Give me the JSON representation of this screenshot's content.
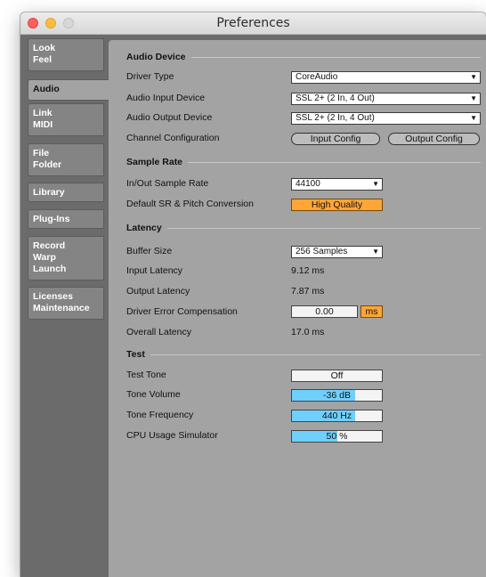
{
  "window": {
    "title": "Preferences"
  },
  "sidebar": {
    "tabs": [
      {
        "lines": [
          "Look",
          "Feel"
        ],
        "active": false
      },
      {
        "lines": [
          "Audio"
        ],
        "active": true
      },
      {
        "lines": [
          "Link",
          "MIDI"
        ],
        "active": false
      },
      {
        "lines": [
          "File",
          "Folder"
        ],
        "active": false
      },
      {
        "lines": [
          "Library"
        ],
        "active": false
      },
      {
        "lines": [
          "Plug-Ins"
        ],
        "active": false
      },
      {
        "lines": [
          "Record",
          "Warp",
          "Launch"
        ],
        "active": false
      },
      {
        "lines": [
          "Licenses",
          "Maintenance"
        ],
        "active": false
      }
    ]
  },
  "audio_device": {
    "heading": "Audio Device",
    "driver_type_label": "Driver Type",
    "driver_type_value": "CoreAudio",
    "input_device_label": "Audio Input Device",
    "input_device_value": "SSL 2+ (2 In, 4 Out)",
    "output_device_label": "Audio Output Device",
    "output_device_value": "SSL 2+ (2 In, 4 Out)",
    "channel_config_label": "Channel Configuration",
    "input_config_button": "Input Config",
    "output_config_button": "Output Config"
  },
  "sample_rate": {
    "heading": "Sample Rate",
    "inout_label": "In/Out Sample Rate",
    "inout_value": "44100",
    "default_sr_label": "Default SR & Pitch Conversion",
    "default_sr_value": "High Quality"
  },
  "latency": {
    "heading": "Latency",
    "buffer_label": "Buffer Size",
    "buffer_value": "256 Samples",
    "input_latency_label": "Input Latency",
    "input_latency_value": "9.12 ms",
    "output_latency_label": "Output Latency",
    "output_latency_value": "7.87 ms",
    "driver_error_label": "Driver Error Compensation",
    "driver_error_value": "0.00",
    "driver_error_unit": "ms",
    "overall_label": "Overall Latency",
    "overall_value": "17.0 ms"
  },
  "test": {
    "heading": "Test",
    "tone_label": "Test Tone",
    "tone_value": "Off",
    "volume_label": "Tone Volume",
    "volume_value": "-36 dB",
    "volume_fill": 0.7,
    "frequency_label": "Tone Frequency",
    "frequency_value": "440 Hz",
    "frequency_fill": 0.7,
    "cpu_label": "CPU Usage Simulator",
    "cpu_value": "50 %",
    "cpu_fill": 0.5
  },
  "icons": {
    "dropdown_arrow": "chevron-down-icon"
  },
  "colors": {
    "accent_orange": "#ffa637",
    "slider_blue": "#6fd0ff"
  }
}
